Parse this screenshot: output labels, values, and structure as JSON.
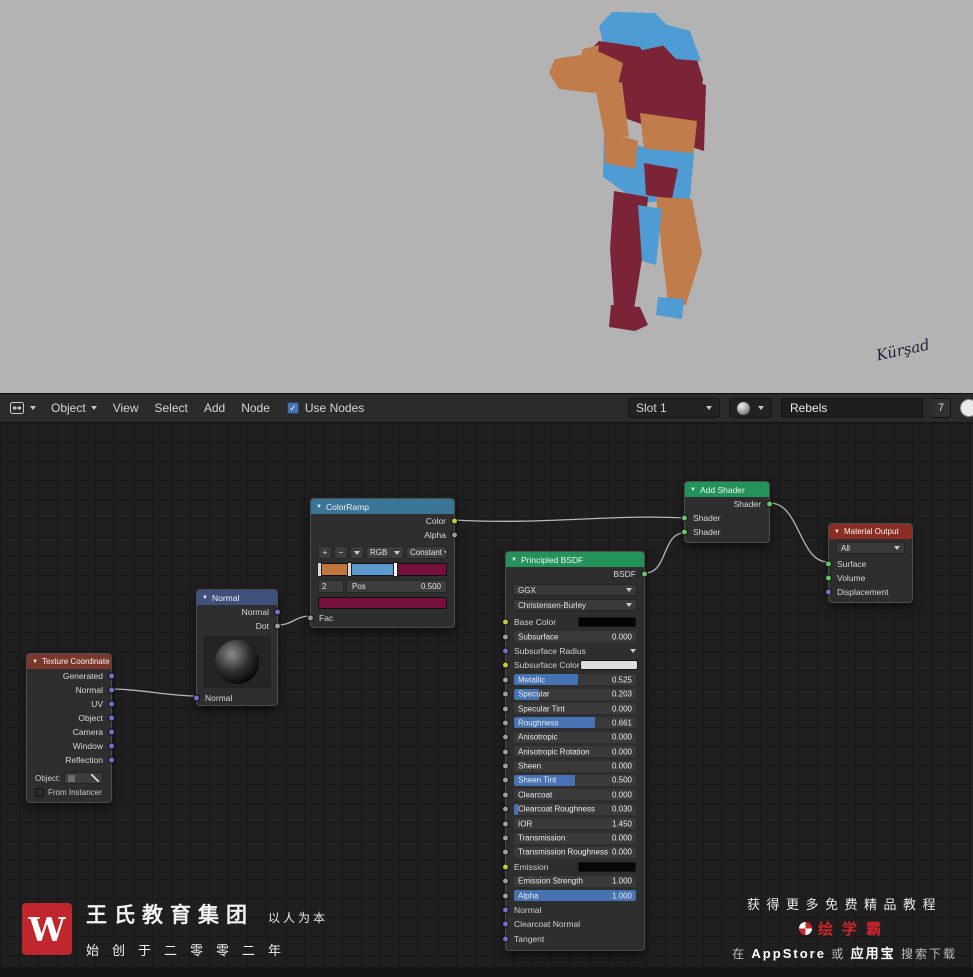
{
  "header": {
    "mode": "Object",
    "menus": [
      "View",
      "Select",
      "Add",
      "Node"
    ],
    "use_nodes_label": "Use Nodes",
    "slot_label": "Slot 1",
    "material_name": "Rebels",
    "users_count": "7"
  },
  "viewport": {
    "signature": "Kürşad",
    "palette": {
      "blue": "#4f9cd4",
      "orange": "#c07c4a",
      "maroon": "#7b2438",
      "background": "#b3b3b3"
    }
  },
  "nodes": {
    "texture_coordinate": {
      "title": "Texture Coordinate",
      "outputs": [
        "Generated",
        "Normal",
        "UV",
        "Object",
        "Camera",
        "Window",
        "Reflection"
      ],
      "object_label": "Object:",
      "from_instancer": "From Instancer"
    },
    "normal": {
      "title": "Normal",
      "outputs": [
        {
          "label": "Normal",
          "socket": "vector"
        },
        {
          "label": "Dot",
          "socket": "gray"
        }
      ],
      "input": "Normal"
    },
    "color_ramp": {
      "title": "ColorRamp",
      "outputs": [
        {
          "label": "Color",
          "socket": "yellow"
        },
        {
          "label": "Alpha",
          "socket": "gray"
        }
      ],
      "tools": {
        "add": "+",
        "remove": "−"
      },
      "color_mode": "RGB",
      "interpolation": "Constant",
      "stop_index": "2",
      "pos_label": "Pos",
      "pos_value": "0.500",
      "selected_color": "#75103c",
      "gradient_stops": [
        {
          "pos": 0.0,
          "color": "#c0763c"
        },
        {
          "pos": 0.24,
          "color": "#5b9bd0"
        },
        {
          "pos": 0.6,
          "color": "#75103c",
          "selected": true
        }
      ],
      "fac_label": "Fac"
    },
    "principled": {
      "title": "Principled BSDF",
      "output": "BSDF",
      "distribution": "GGX",
      "subsurface_method": "Christensen-Burley",
      "rows": [
        {
          "label": "Base Color",
          "type": "color",
          "socket": "yellow",
          "swatch": "#060606"
        },
        {
          "label": "Subsurface",
          "type": "slider",
          "socket": "gray",
          "value": "0.000",
          "fill": 0
        },
        {
          "label": "Subsurface Radius",
          "type": "collapsed",
          "socket": "vector"
        },
        {
          "label": "Subsurface Color",
          "type": "color",
          "socket": "yellow",
          "swatch": "#dcdcdc"
        },
        {
          "label": "Metallic",
          "type": "slider",
          "socket": "gray",
          "value": "0.525",
          "fill": 0.525
        },
        {
          "label": "Specular",
          "type": "slider",
          "socket": "gray",
          "value": "0.203",
          "fill": 0.203
        },
        {
          "label": "Specular Tint",
          "type": "slider",
          "socket": "gray",
          "value": "0.000",
          "fill": 0
        },
        {
          "label": "Roughness",
          "type": "slider",
          "socket": "gray",
          "value": "0.661",
          "fill": 0.661
        },
        {
          "label": "Anisotropic",
          "type": "slider",
          "socket": "gray",
          "value": "0.000",
          "fill": 0
        },
        {
          "label": "Anisotropic Rotation",
          "type": "slider",
          "socket": "gray",
          "value": "0.000",
          "fill": 0
        },
        {
          "label": "Sheen",
          "type": "slider",
          "socket": "gray",
          "value": "0.000",
          "fill": 0
        },
        {
          "label": "Sheen Tint",
          "type": "slider",
          "socket": "gray",
          "value": "0.500",
          "fill": 0.5
        },
        {
          "label": "Clearcoat",
          "type": "slider",
          "socket": "gray",
          "value": "0.000",
          "fill": 0
        },
        {
          "label": "Clearcoat Roughness",
          "type": "slider",
          "socket": "gray",
          "value": "0.030",
          "fill": 0.03
        },
        {
          "label": "IOR",
          "type": "slider",
          "socket": "gray",
          "value": "1.450",
          "fill": 0
        },
        {
          "label": "Transmission",
          "type": "slider",
          "socket": "gray",
          "value": "0.000",
          "fill": 0
        },
        {
          "label": "Transmission Roughness",
          "type": "slider",
          "socket": "gray",
          "value": "0.000",
          "fill": 0
        },
        {
          "label": "Emission",
          "type": "color",
          "socket": "yellow",
          "swatch": "#060606"
        },
        {
          "label": "Emission Strength",
          "type": "slider",
          "socket": "gray",
          "value": "1.000",
          "fill": 0
        },
        {
          "label": "Alpha",
          "type": "slider",
          "socket": "gray",
          "value": "1.000",
          "fill": 1
        },
        {
          "label": "Normal",
          "type": "plain",
          "socket": "vector"
        },
        {
          "label": "Clearcoat Normal",
          "type": "plain",
          "socket": "vector"
        },
        {
          "label": "Tangent",
          "type": "plain",
          "socket": "vector"
        }
      ]
    },
    "add_shader": {
      "title": "Add Shader",
      "output": "Shader",
      "inputs": [
        "Shader",
        "Shader"
      ]
    },
    "material_output": {
      "title": "Material Output",
      "target": "All",
      "inputs": [
        {
          "label": "Surface",
          "socket": "shader"
        },
        {
          "label": "Volume",
          "socket": "shader"
        },
        {
          "label": "Displacement",
          "socket": "vector"
        }
      ]
    }
  },
  "watermark": {
    "logo_letter": "W",
    "logo_color": "#c0272d",
    "brand": "王氏教育集团",
    "slogan": "以人为本",
    "since": "始创于二零零二年"
  },
  "promo": {
    "line1": "获得更多免费精品教程",
    "brand": "绘学霸",
    "brand_color": "#c9252b",
    "line2_prefix": "在",
    "line2_store": "AppStore",
    "line2_or": "或",
    "line2_app": "应用宝",
    "line2_suffix": "搜索下载"
  }
}
